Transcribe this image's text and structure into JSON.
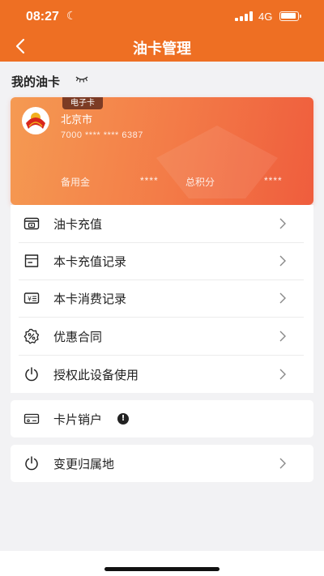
{
  "status_bar": {
    "time": "08:27",
    "network": "4G"
  },
  "nav": {
    "title": "油卡管理",
    "back_icon": "chevron-left-icon"
  },
  "section": {
    "title": "我的油卡",
    "visibility_icon": "eye-closed-icon"
  },
  "card": {
    "tag": "电子卡",
    "city": "北京市",
    "number": "7000 **** **** 6387",
    "reserve_label": "备用金",
    "reserve_value": "****",
    "points_label": "总积分",
    "points_value": "****",
    "colors": {
      "start": "#f59a52",
      "end": "#ef5d3d"
    }
  },
  "menu": {
    "items": [
      {
        "label": "油卡充值",
        "icon": "wallet-icon"
      },
      {
        "label": "本卡充值记录",
        "icon": "document-icon"
      },
      {
        "label": "本卡消费记录",
        "icon": "receipt-yen-icon"
      },
      {
        "label": "优惠合同",
        "icon": "discount-badge-icon"
      },
      {
        "label": "授权此设备使用",
        "icon": "power-icon"
      }
    ]
  },
  "cancel_card": {
    "label": "卡片销户",
    "icon": "card-icon",
    "warning_icon": "exclamation-circle-icon",
    "warning_glyph": "!"
  },
  "change_region": {
    "label": "变更归属地",
    "icon": "power-icon"
  },
  "theme": {
    "accent": "#ee6f23",
    "background": "#f2f2f4"
  }
}
